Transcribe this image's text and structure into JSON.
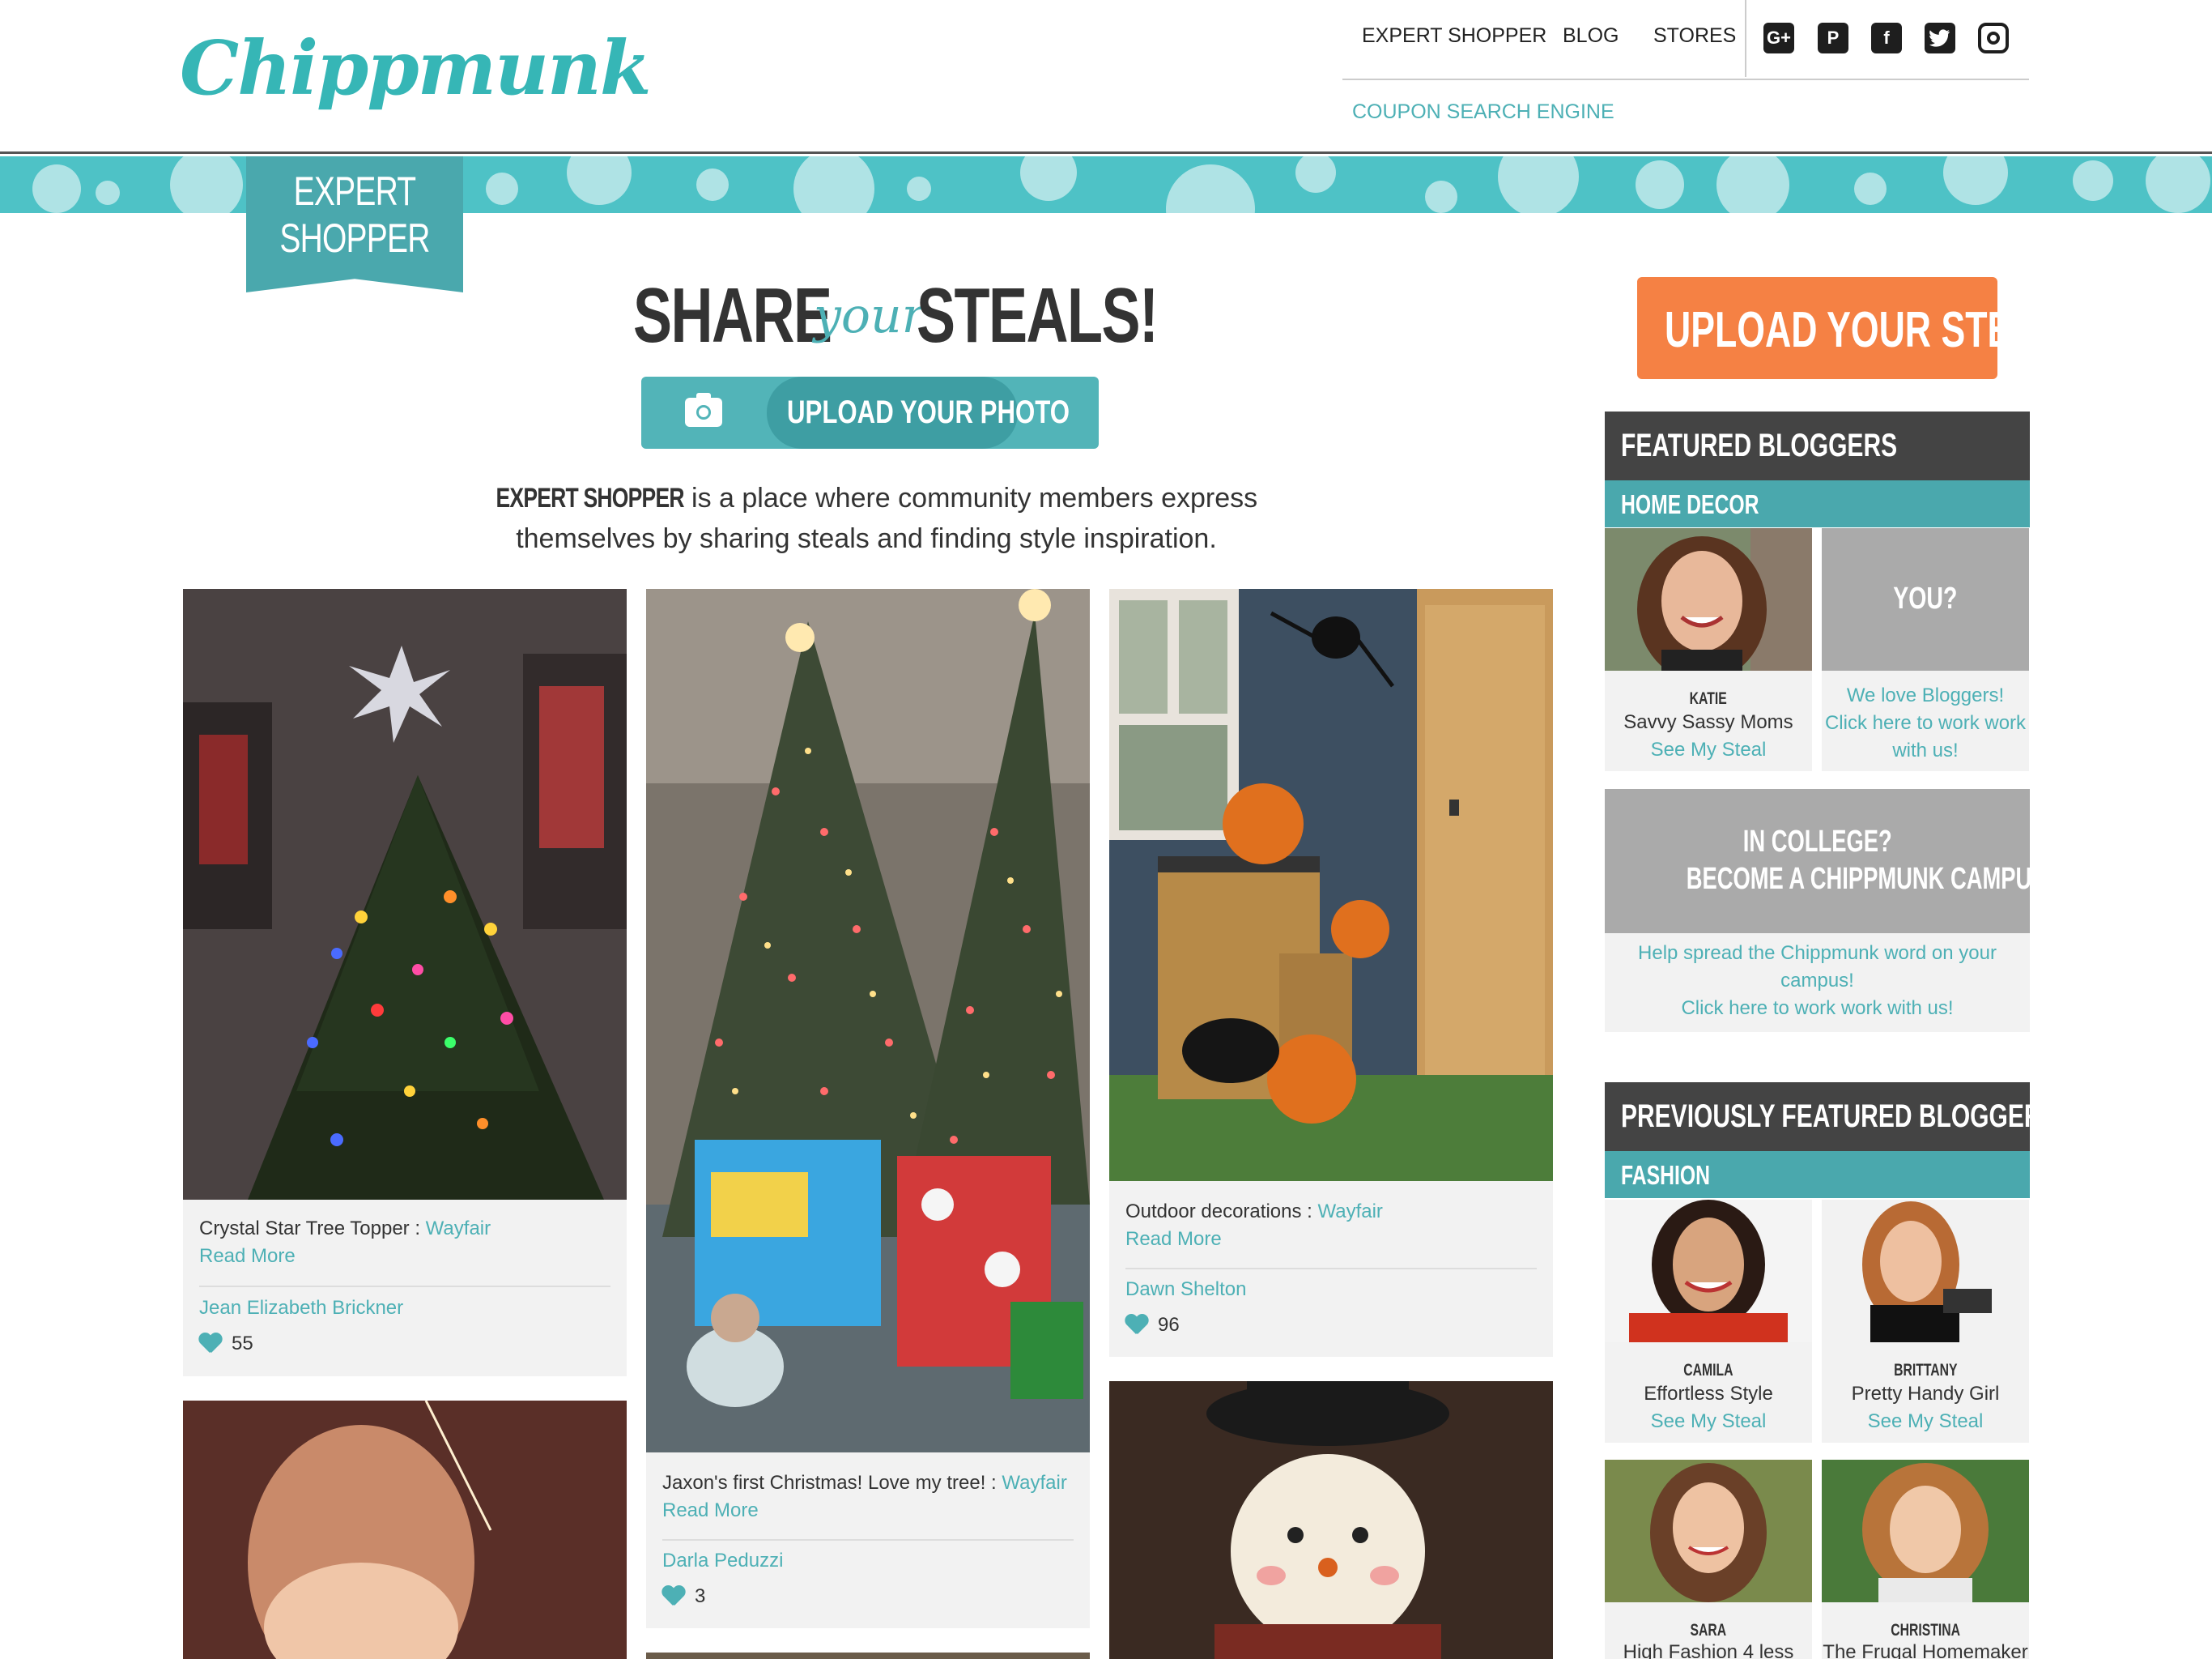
{
  "brand": {
    "logo_text": "Chippmunk"
  },
  "nav": {
    "items": [
      "EXPERT SHOPPER",
      "BLOG",
      "STORES"
    ],
    "coupon": "COUPON SEARCH ENGINE",
    "social": [
      "google-plus-icon",
      "pinterest-icon",
      "facebook-icon",
      "twitter-icon",
      "instagram-icon"
    ]
  },
  "ribbon": {
    "line1": "EXPERT",
    "line2": "SHOPPER"
  },
  "hero": {
    "share": "SHARE",
    "your": "your",
    "steals": "STEALS!",
    "upload_photo": "UPLOAD YOUR PHOTO",
    "intro_brand": "EXPERT SHOPPER",
    "intro_text1": " is a place where community members express",
    "intro_text2": "themselves by sharing steals and finding style inspiration."
  },
  "posts": [
    {
      "caption": "Crystal Star Tree Topper : ",
      "store": "Wayfair",
      "read_more": "Read More",
      "author": "Jean Elizabeth Brickner",
      "likes": "55"
    },
    {
      "caption": "Jaxon's first Christmas! Love my tree! : ",
      "store": "Wayfair",
      "read_more": "Read More",
      "author": "Darla Peduzzi",
      "likes": "3"
    },
    {
      "caption": "Outdoor decorations : ",
      "store": "Wayfair",
      "read_more": "Read More",
      "author": "Dawn Shelton",
      "likes": "96"
    }
  ],
  "sidebar": {
    "upload_steal": "UPLOAD YOUR STEAL",
    "featured_title": "FEATURED BLOGGERS",
    "featured_category": "HOME DECOR",
    "featured": [
      {
        "name": "KATIE",
        "site": "Savvy Sassy Moms",
        "steal": "See My Steal"
      }
    ],
    "you": {
      "title": "YOU?",
      "line1": "We love Bloggers!",
      "line2": "Click here to work work",
      "line3": "with us!"
    },
    "college": {
      "line1": "IN COLLEGE?",
      "line2": "BECOME A CHIPPMUNK CAMPUS REP!",
      "msg1": "Help spread the Chippmunk word on your",
      "msg2": "campus!",
      "msg3": "Click here to work work with us!"
    },
    "previous_title": "PREVIOUSLY FEATURED BLOGGERS",
    "previous_category": "FASHION",
    "previous": [
      {
        "name": "CAMILA",
        "site": "Effortless Style",
        "steal": "See My Steal"
      },
      {
        "name": "BRITTANY",
        "site": "Pretty Handy Girl",
        "steal": "See My Steal"
      },
      {
        "name": "SARA",
        "site": "High Fashion 4 less"
      },
      {
        "name": "CHRISTINA",
        "site": "The Frugal Homemaker"
      }
    ]
  }
}
